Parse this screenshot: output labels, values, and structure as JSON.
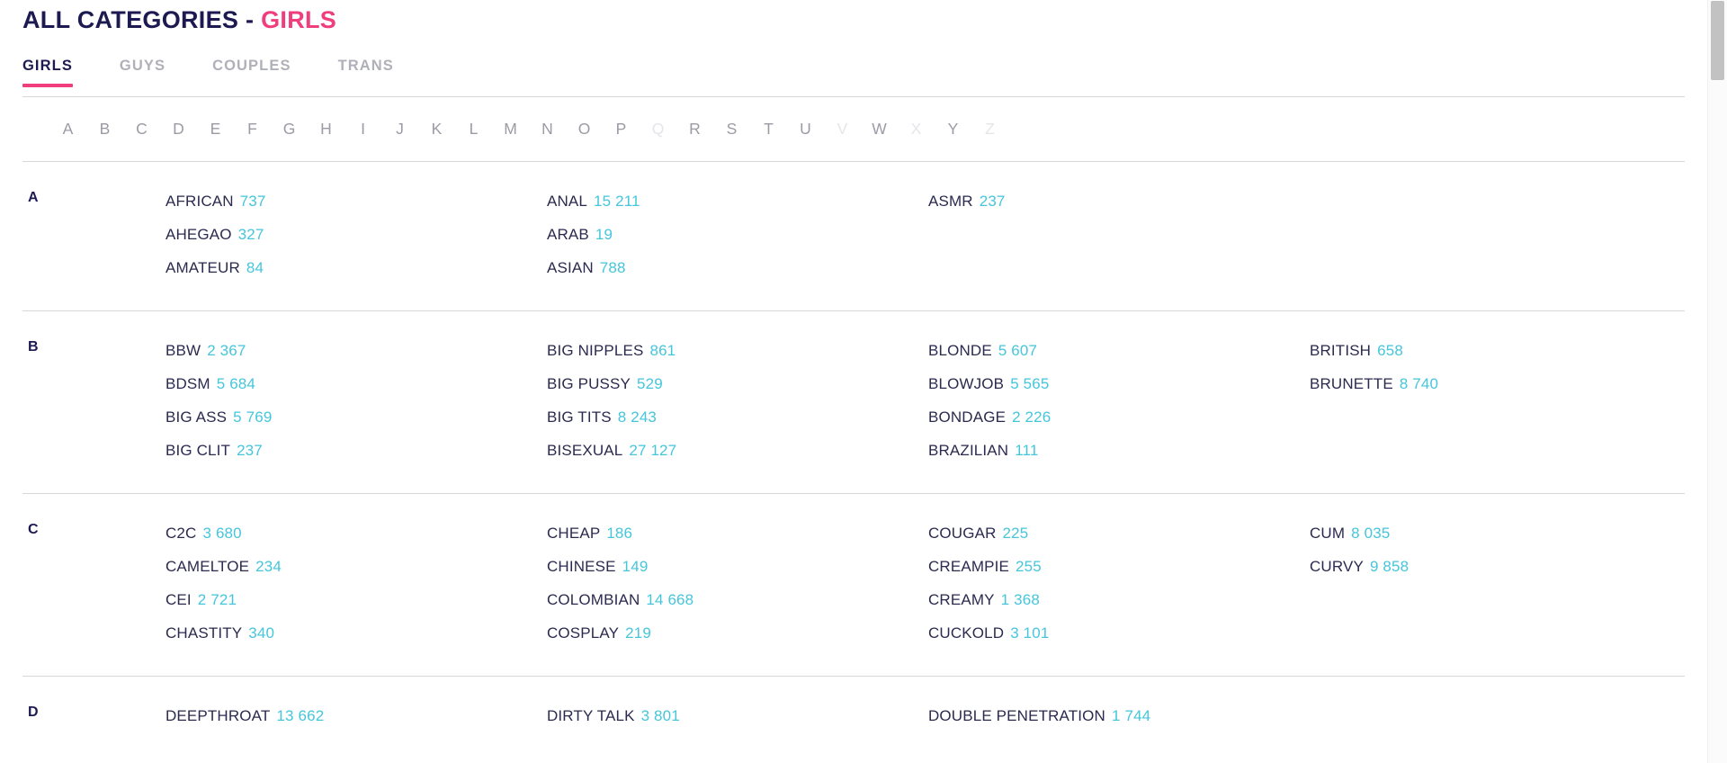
{
  "header": {
    "title_main": "ALL CATEGORIES - ",
    "title_accent": "GIRLS"
  },
  "tabs": [
    {
      "label": "GIRLS",
      "active": true
    },
    {
      "label": "GUYS",
      "active": false
    },
    {
      "label": "COUPLES",
      "active": false
    },
    {
      "label": "TRANS",
      "active": false
    }
  ],
  "alphabet": [
    {
      "letter": "A",
      "enabled": true
    },
    {
      "letter": "B",
      "enabled": true
    },
    {
      "letter": "C",
      "enabled": true
    },
    {
      "letter": "D",
      "enabled": true
    },
    {
      "letter": "E",
      "enabled": true
    },
    {
      "letter": "F",
      "enabled": true
    },
    {
      "letter": "G",
      "enabled": true
    },
    {
      "letter": "H",
      "enabled": true
    },
    {
      "letter": "I",
      "enabled": true
    },
    {
      "letter": "J",
      "enabled": true
    },
    {
      "letter": "K",
      "enabled": true
    },
    {
      "letter": "L",
      "enabled": true
    },
    {
      "letter": "M",
      "enabled": true
    },
    {
      "letter": "N",
      "enabled": true
    },
    {
      "letter": "O",
      "enabled": true
    },
    {
      "letter": "P",
      "enabled": true
    },
    {
      "letter": "Q",
      "enabled": false
    },
    {
      "letter": "R",
      "enabled": true
    },
    {
      "letter": "S",
      "enabled": true
    },
    {
      "letter": "T",
      "enabled": true
    },
    {
      "letter": "U",
      "enabled": true
    },
    {
      "letter": "V",
      "enabled": false
    },
    {
      "letter": "W",
      "enabled": true
    },
    {
      "letter": "X",
      "enabled": false
    },
    {
      "letter": "Y",
      "enabled": true
    },
    {
      "letter": "Z",
      "enabled": false
    }
  ],
  "sections": [
    {
      "letter": "A",
      "columns": [
        [
          {
            "name": "AFRICAN",
            "count": "737"
          },
          {
            "name": "AHEGAO",
            "count": "327"
          },
          {
            "name": "AMATEUR",
            "count": "84"
          }
        ],
        [
          {
            "name": "ANAL",
            "count": "15 211"
          },
          {
            "name": "ARAB",
            "count": "19"
          },
          {
            "name": "ASIAN",
            "count": "788"
          }
        ],
        [
          {
            "name": "ASMR",
            "count": "237"
          }
        ],
        []
      ]
    },
    {
      "letter": "B",
      "columns": [
        [
          {
            "name": "BBW",
            "count": "2 367"
          },
          {
            "name": "BDSM",
            "count": "5 684"
          },
          {
            "name": "BIG ASS",
            "count": "5 769"
          },
          {
            "name": "BIG CLIT",
            "count": "237"
          }
        ],
        [
          {
            "name": "BIG NIPPLES",
            "count": "861"
          },
          {
            "name": "BIG PUSSY",
            "count": "529"
          },
          {
            "name": "BIG TITS",
            "count": "8 243"
          },
          {
            "name": "BISEXUAL",
            "count": "27 127"
          }
        ],
        [
          {
            "name": "BLONDE",
            "count": "5 607"
          },
          {
            "name": "BLOWJOB",
            "count": "5 565"
          },
          {
            "name": "BONDAGE",
            "count": "2 226"
          },
          {
            "name": "BRAZILIAN",
            "count": "111"
          }
        ],
        [
          {
            "name": "BRITISH",
            "count": "658"
          },
          {
            "name": "BRUNETTE",
            "count": "8 740"
          }
        ]
      ]
    },
    {
      "letter": "C",
      "columns": [
        [
          {
            "name": "C2C",
            "count": "3 680"
          },
          {
            "name": "CAMELTOE",
            "count": "234"
          },
          {
            "name": "CEI",
            "count": "2 721"
          },
          {
            "name": "CHASTITY",
            "count": "340"
          }
        ],
        [
          {
            "name": "CHEAP",
            "count": "186"
          },
          {
            "name": "CHINESE",
            "count": "149"
          },
          {
            "name": "COLOMBIAN",
            "count": "14 668"
          },
          {
            "name": "COSPLAY",
            "count": "219"
          }
        ],
        [
          {
            "name": "COUGAR",
            "count": "225"
          },
          {
            "name": "CREAMPIE",
            "count": "255"
          },
          {
            "name": "CREAMY",
            "count": "1 368"
          },
          {
            "name": "CUCKOLD",
            "count": "3 101"
          }
        ],
        [
          {
            "name": "CUM",
            "count": "8 035"
          },
          {
            "name": "CURVY",
            "count": "9 858"
          }
        ]
      ]
    },
    {
      "letter": "D",
      "columns": [
        [
          {
            "name": "DEEPTHROAT",
            "count": "13 662"
          }
        ],
        [
          {
            "name": "DIRTY TALK",
            "count": "3 801"
          }
        ],
        [
          {
            "name": "DOUBLE PENETRATION",
            "count": "1 744"
          }
        ],
        []
      ]
    }
  ],
  "colors": {
    "navy": "#1d1a52",
    "pink": "#ef3d7d",
    "cyan": "#45c6db",
    "muted": "#b0b0b8",
    "divider": "#d8d8d8"
  }
}
